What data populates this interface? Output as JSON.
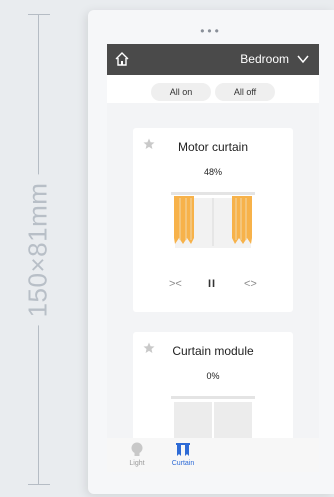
{
  "annotation": {
    "dimension_text": "150×81mm"
  },
  "device": {
    "dots": "•••"
  },
  "header": {
    "room": "Bedroom"
  },
  "actions": {
    "all_on": "All on",
    "all_off": "All off"
  },
  "cards": [
    {
      "title": "Motor curtain",
      "percent": "48%",
      "controls": {
        "close": "><",
        "pause": "II",
        "open": "<>"
      }
    },
    {
      "title": "Curtain module",
      "percent": "0%"
    }
  ],
  "tabs": [
    {
      "label": "Light",
      "active": false
    },
    {
      "label": "Curtain",
      "active": true
    }
  ],
  "colors": {
    "accent": "#2e6bd6",
    "curtain_orange": "#f7b24a",
    "header": "#4a4a4a"
  }
}
